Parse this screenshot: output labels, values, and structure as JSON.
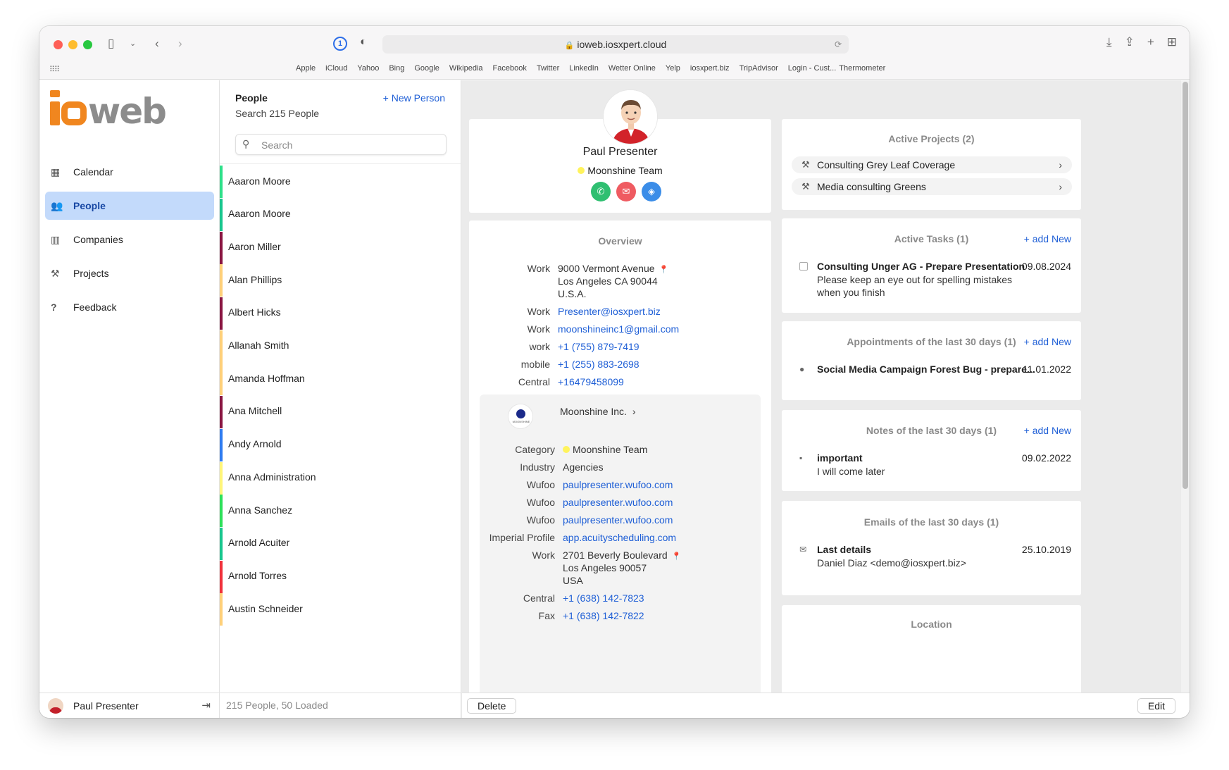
{
  "browser": {
    "url": "ioweb.iosxpert.cloud",
    "bookmarks": [
      "Apple",
      "iCloud",
      "Yahoo",
      "Bing",
      "Google",
      "Wikipedia",
      "Facebook",
      "Twitter",
      "LinkedIn",
      "Wetter Online",
      "Yelp",
      "iosxpert.biz",
      "TripAdvisor",
      "Login - Cust...",
      "Thermometer"
    ]
  },
  "logo": {
    "text": "web"
  },
  "sidebar": {
    "items": [
      {
        "label": "Calendar",
        "icon": "calendar-icon",
        "active": false
      },
      {
        "label": "People",
        "icon": "people-icon",
        "active": true
      },
      {
        "label": "Companies",
        "icon": "building-icon",
        "active": false
      },
      {
        "label": "Projects",
        "icon": "hammer-icon",
        "active": false
      },
      {
        "label": "Feedback",
        "icon": "question-icon",
        "active": false
      }
    ],
    "user": "Paul Presenter"
  },
  "people": {
    "title": "People",
    "subtitle": "Search 215 People",
    "new_label": "+ New Person",
    "search_placeholder": "Search",
    "footer": "215 People, 50 Loaded",
    "list": [
      {
        "name": "Aaaron Moore",
        "color": "#2ee08a"
      },
      {
        "name": "Aaaron Moore",
        "color": "#19c68e"
      },
      {
        "name": "Aaron Miller",
        "color": "#8a1642"
      },
      {
        "name": "Alan Phillips",
        "color": "#ffd07a"
      },
      {
        "name": "Albert Hicks",
        "color": "#8a1642"
      },
      {
        "name": "Allanah Smith",
        "color": "#ffd07a"
      },
      {
        "name": "Amanda Hoffman",
        "color": "#ffd07a"
      },
      {
        "name": "Ana Mitchell",
        "color": "#8a1642"
      },
      {
        "name": "Andy Arnold",
        "color": "#2f7cf0"
      },
      {
        "name": "Anna Administration",
        "color": "#fff57a"
      },
      {
        "name": "Anna Sanchez",
        "color": "#2ee05a"
      },
      {
        "name": "Arnold Acuiter",
        "color": "#19c68e"
      },
      {
        "name": "Arnold Torres",
        "color": "#f0323c"
      },
      {
        "name": "Austin Schneider",
        "color": "#ffd07a"
      }
    ]
  },
  "profile": {
    "name": "Paul Presenter",
    "team": "Moonshine Team"
  },
  "overview": {
    "title": "Overview",
    "address_label": "Work",
    "address_lines": [
      "9000 Vermont Avenue",
      "Los Angeles CA 90044",
      "U.S.A."
    ],
    "fields": [
      {
        "label": "Work",
        "value": "Presenter@iosxpert.biz"
      },
      {
        "label": "Work",
        "value": "moonshineinc1@gmail.com"
      },
      {
        "label": "work",
        "value": "+1 (755) 879-7419"
      },
      {
        "label": "mobile",
        "value": "+1 (255) 883-2698"
      },
      {
        "label": "Central",
        "value": "+16479458099"
      }
    ],
    "company": {
      "name": "Moonshine Inc.",
      "logo_text": "MOONSHINE",
      "category_label": "Category",
      "category": "Moonshine Team",
      "industry_label": "Industry",
      "industry": "Agencies",
      "links": [
        {
          "label": "Wufoo",
          "value": "paulpresenter.wufoo.com"
        },
        {
          "label": "Wufoo",
          "value": "paulpresenter.wufoo.com"
        },
        {
          "label": "Wufoo",
          "value": "paulpresenter.wufoo.com"
        },
        {
          "label": "Imperial Profile",
          "value": "app.acuityscheduling.com"
        }
      ],
      "address_label": "Work",
      "address_lines": [
        "2701 Beverly Boulevard",
        "Los Angeles 90057",
        "USA"
      ],
      "phones": [
        {
          "label": "Central",
          "value": "+1 (638) 142-7823"
        },
        {
          "label": "Fax",
          "value": "+1 (638) 142-7822"
        }
      ]
    }
  },
  "projects": {
    "title": "Active Projects (2)",
    "items": [
      "Consulting Grey Leaf Coverage",
      "Media consulting Greens"
    ]
  },
  "tasks": {
    "title": "Active Tasks (1)",
    "add_label": "+ add New",
    "item": {
      "title": "Consulting Unger AG - Prepare Presentation",
      "date": "09.08.2024",
      "description": "Please keep an eye out for spelling mistakes when you finish"
    }
  },
  "appointments": {
    "title": "Appointments of the last 30 days (1)",
    "add_label": "+ add New",
    "item": {
      "title": "Social Media Campaign Forest Bug - prepare...",
      "date": "11.01.2022"
    }
  },
  "notes": {
    "title": "Notes of the last 30 days (1)",
    "add_label": "+ add New",
    "item": {
      "title": "important",
      "sub": "I will come later",
      "date": "09.02.2022"
    }
  },
  "emails": {
    "title": "Emails of the last 30 days (1)",
    "item": {
      "title": "Last details",
      "sub": "Daniel Diaz <demo@iosxpert.biz>",
      "date": "25.10.2019"
    }
  },
  "location": {
    "title": "Location"
  },
  "footer": {
    "delete_label": "Delete",
    "edit_label": "Edit"
  }
}
